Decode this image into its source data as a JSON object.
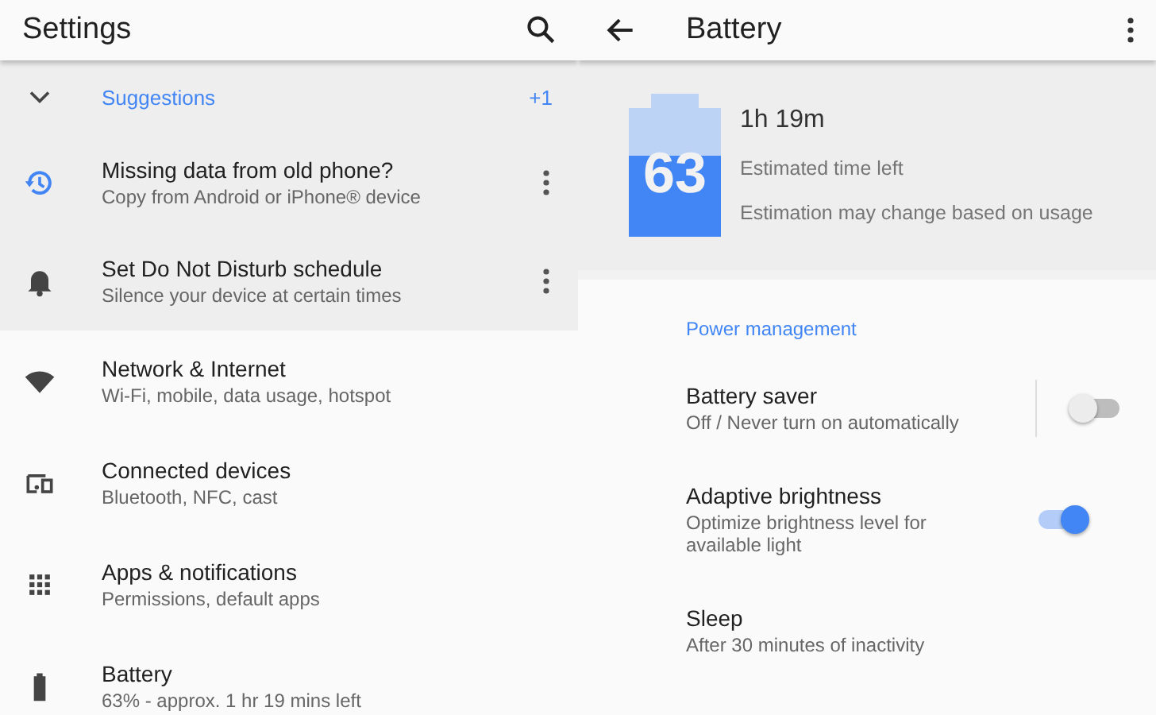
{
  "settings": {
    "title": "Settings",
    "suggestions": {
      "label": "Suggestions",
      "count": "+1",
      "expanded": true,
      "items": [
        {
          "title": "Missing data from old phone?",
          "subtitle": "Copy from Android or iPhone® device"
        },
        {
          "title": "Set Do Not Disturb schedule",
          "subtitle": "Silence your device at certain times"
        }
      ]
    },
    "items": [
      {
        "title": "Network & Internet",
        "subtitle": "Wi-Fi, mobile, data usage, hotspot"
      },
      {
        "title": "Connected devices",
        "subtitle": "Bluetooth, NFC, cast"
      },
      {
        "title": "Apps & notifications",
        "subtitle": "Permissions, default apps"
      },
      {
        "title": "Battery",
        "subtitle": "63% - approx. 1 hr 19 mins left"
      }
    ]
  },
  "battery": {
    "title": "Battery",
    "level": 0.63,
    "percent": "63",
    "time": "1h 19m",
    "time_label": "Estimated time left",
    "note": "Estimation may change based on usage",
    "section": "Power management",
    "settings": [
      {
        "kind": "split-switch",
        "title": "Battery saver",
        "subtitle": "Off / Never turn on automatically",
        "on": false
      },
      {
        "kind": "switch",
        "title": "Adaptive brightness",
        "subtitle": "Optimize brightness level for available light",
        "on": true
      },
      {
        "kind": "plain",
        "title": "Sleep",
        "subtitle": "After 30 minutes of inactivity"
      }
    ]
  }
}
